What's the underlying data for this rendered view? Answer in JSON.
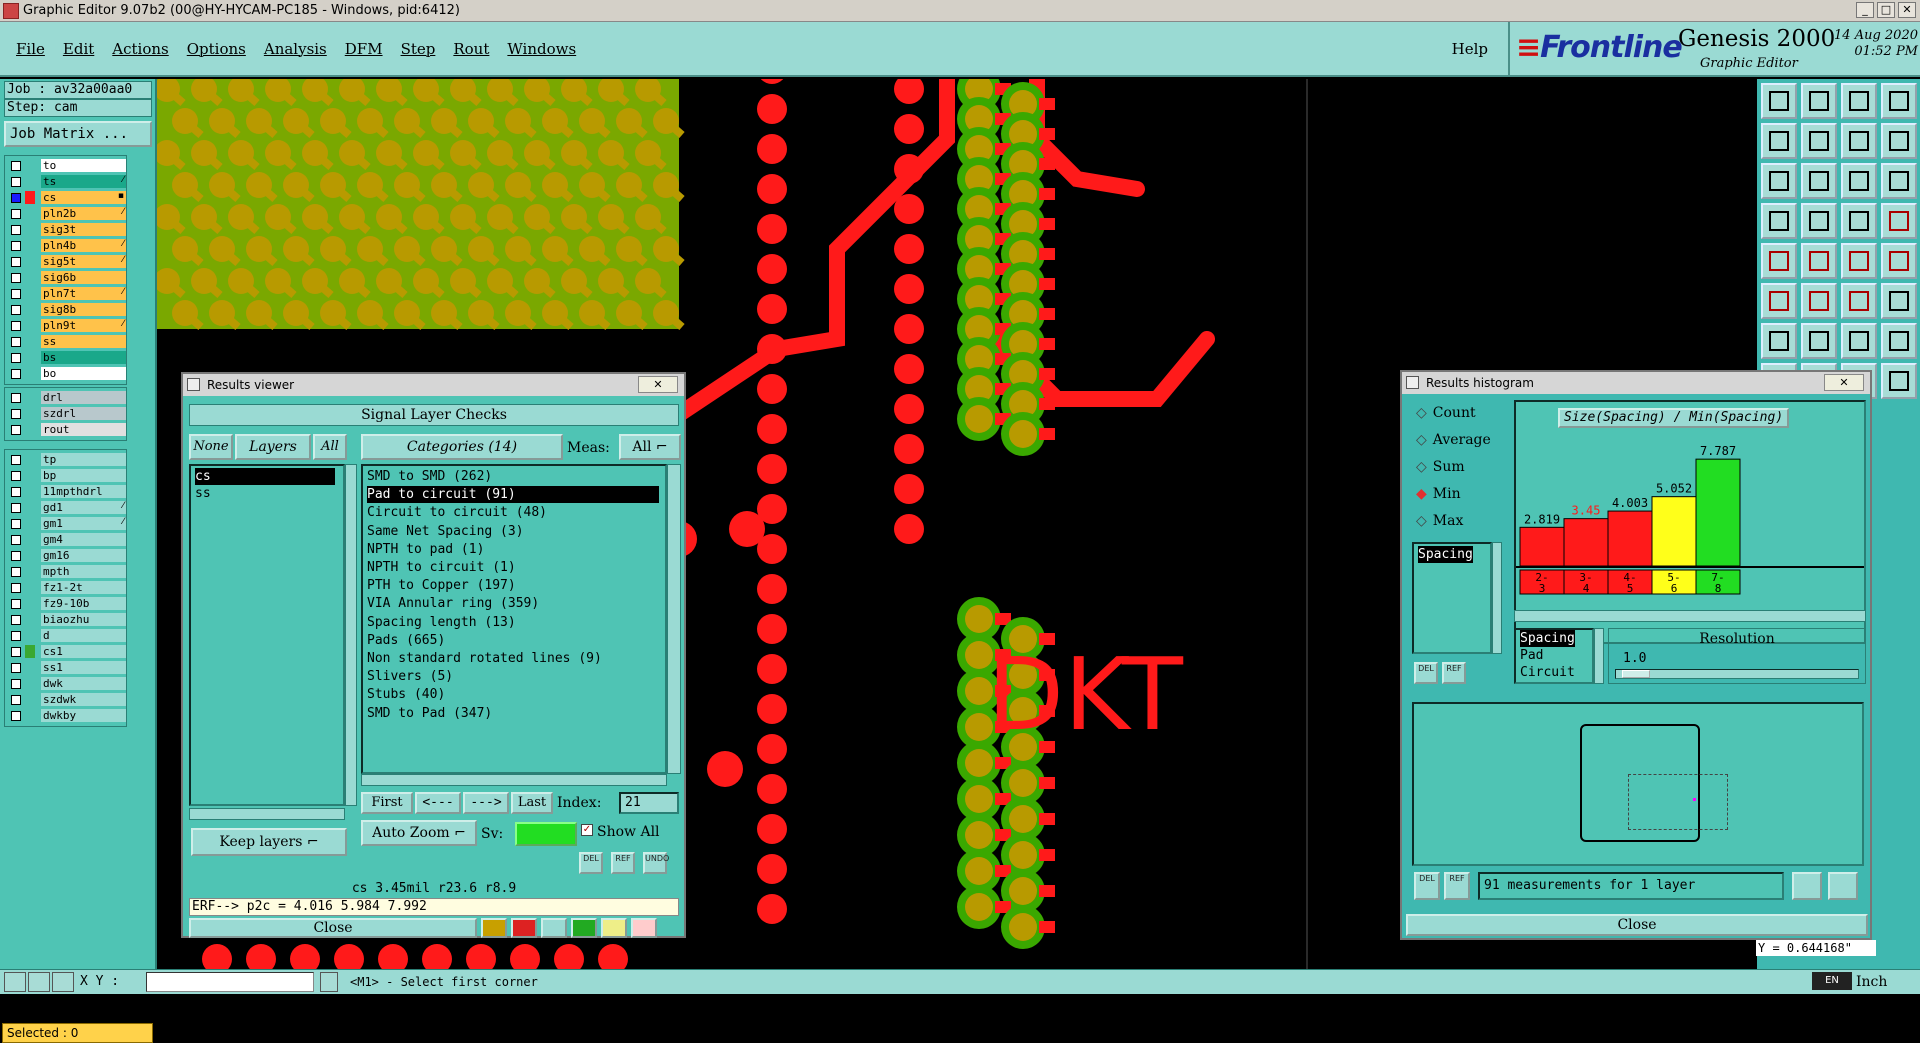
{
  "window": {
    "title": "Graphic Editor 9.07b2 (00@HY-HYCAM-PC185 - Windows, pid:6412)"
  },
  "menu": {
    "items": [
      "File",
      "Edit",
      "Actions",
      "Options",
      "Analysis",
      "DFM",
      "Step",
      "Rout",
      "Windows"
    ],
    "help": "Help"
  },
  "brand": {
    "logo": "Frontline",
    "product": "Genesis 2000",
    "subtitle": "Graphic Editor",
    "date": "14 Aug 2020",
    "time": "01:52 PM"
  },
  "job": {
    "job": "Job : av32a00aa0",
    "step": "Step: cam",
    "matrix_button": "Job Matrix ..."
  },
  "layers_board": [
    {
      "name": "to",
      "color": "#ffffff"
    },
    {
      "name": "ts",
      "color": "#1aa88a",
      "mark": "⁄"
    },
    {
      "name": "cs",
      "color": "#ffc24a",
      "mark": "▪",
      "active": true
    },
    {
      "name": "pln2b",
      "color": "#ffc24a",
      "mark": "⁄"
    },
    {
      "name": "sig3t",
      "color": "#ffc24a"
    },
    {
      "name": "pln4b",
      "color": "#ffc24a",
      "mark": "⁄"
    },
    {
      "name": "sig5t",
      "color": "#ffc24a",
      "mark": "⁄"
    },
    {
      "name": "sig6b",
      "color": "#ffc24a"
    },
    {
      "name": "pln7t",
      "color": "#ffc24a",
      "mark": "⁄"
    },
    {
      "name": "sig8b",
      "color": "#ffc24a"
    },
    {
      "name": "pln9t",
      "color": "#ffc24a",
      "mark": "⁄"
    },
    {
      "name": "ss",
      "color": "#ffc24a"
    },
    {
      "name": "bs",
      "color": "#1aa88a"
    },
    {
      "name": "bo",
      "color": "#ffffff"
    }
  ],
  "layers_drill": [
    {
      "name": "drl",
      "color": "#b8c8cc"
    },
    {
      "name": "szdrl",
      "color": "#b8c8cc"
    },
    {
      "name": "rout",
      "color": "#e0e0e0"
    }
  ],
  "layers_misc": [
    {
      "name": "tp"
    },
    {
      "name": "bp"
    },
    {
      "name": "11mpthdrl"
    },
    {
      "name": "gd1",
      "mark": "⁄"
    },
    {
      "name": "gm1",
      "mark": "⁄"
    },
    {
      "name": "gm4"
    },
    {
      "name": "gm16"
    },
    {
      "name": "mpth"
    },
    {
      "name": "fz1-2t"
    },
    {
      "name": "fz9-10b"
    },
    {
      "name": "biaozhu"
    },
    {
      "name": "d"
    },
    {
      "name": "cs1",
      "swatch": "#3aa832"
    },
    {
      "name": "ss1"
    },
    {
      "name": "dwk"
    },
    {
      "name": "szdwk"
    },
    {
      "name": "dwkby"
    }
  ],
  "selected": "Selected : 0",
  "canvas": {
    "label": "DKT",
    "y_readout": "Y = 0.644168\""
  },
  "results_viewer": {
    "title": "Results viewer",
    "header": "Signal Layer Checks",
    "layer_filter": {
      "none": "None",
      "layers": "Layers",
      "all": "All"
    },
    "layers": [
      "cs",
      "ss"
    ],
    "categories_label": "Categories (14)",
    "meas_label": "Meas:",
    "meas_value": "All",
    "categories": [
      "SMD to SMD (262)",
      "Pad to circuit (91)",
      "Circuit to circuit (48)",
      "Same Net Spacing (3)",
      "NPTH to pad (1)",
      "NPTH to circuit (1)",
      "PTH to Copper (197)",
      "VIA Annular ring (359)",
      "Spacing length (13)",
      "Pads (665)",
      "Non standard rotated lines (9)",
      "Slivers (5)",
      "Stubs (40)",
      "SMD to Pad (347)"
    ],
    "selected_category": 1,
    "nav": {
      "first": "First",
      "prev": "<---",
      "next": "--->",
      "last": "Last",
      "index_label": "Index:",
      "index_value": "21"
    },
    "auto_zoom": "Auto Zoom",
    "sv_label": "Sv:",
    "show_all": "Show All",
    "keep_layers": "Keep layers",
    "status": "cs 3.45mil  r23.6  r8.9",
    "erf": "ERF--> p2c = 4.016 5.984 7.992",
    "close": "Close",
    "icon_labels": {
      "del": "DEL",
      "ref": "REF",
      "undo": "UNDO"
    }
  },
  "histogram": {
    "title": "Results histogram",
    "modes": [
      "Count",
      "Average",
      "Sum",
      "Min",
      "Max"
    ],
    "selected_mode": "Min",
    "type_list": [
      "Spacing"
    ],
    "chart_title": "Size(Spacing) / Min(Spacing)",
    "resolution_label": "Resolution",
    "resolution_value": "1.0",
    "measure_list": [
      "Spacing",
      "Pad",
      "Circuit"
    ],
    "summary": "91 measurements for 1 layer",
    "close": "Close",
    "icon_labels": {
      "del": "DEL",
      "ref": "REF"
    }
  },
  "chart_data": {
    "type": "bar",
    "title": "Size(Spacing) / Min(Spacing)",
    "categories": [
      "2-3",
      "3-4",
      "4-5",
      "5-6",
      "7-8"
    ],
    "values": [
      2.819,
      3.45,
      4.003,
      5.052,
      7.787
    ],
    "colors": [
      "#ff1a1a",
      "#ff1a1a",
      "#ff1a1a",
      "#ffff1a",
      "#22dd22"
    ],
    "label_colors": [
      "#000000",
      "#ff1a1a",
      "#000000",
      "#000000",
      "#000000"
    ],
    "ylim": [
      0,
      8.5
    ]
  },
  "bottom": {
    "xy_label": "X Y :",
    "prompt": "<M1> - Select first corner",
    "unit": "Inch",
    "lang": "EN"
  }
}
